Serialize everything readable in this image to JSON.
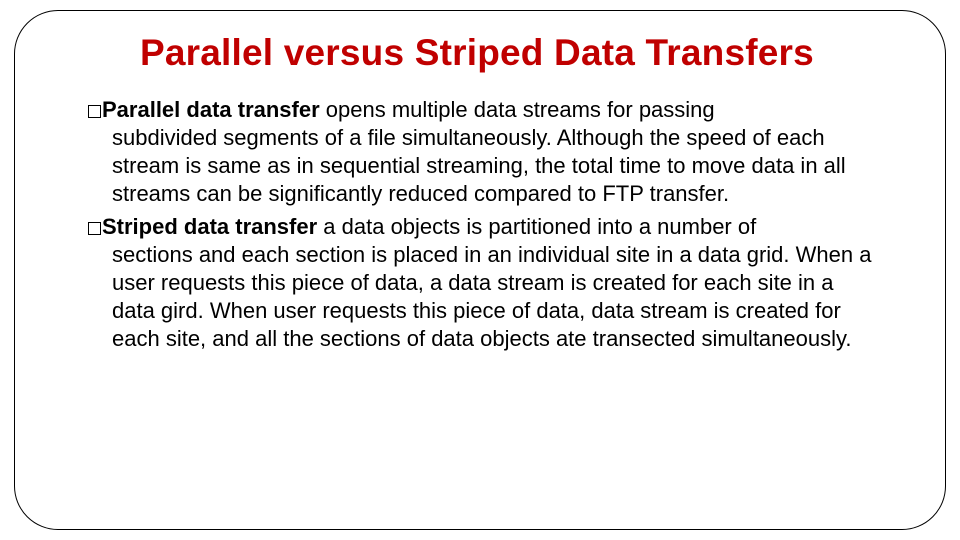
{
  "title": "Parallel versus Striped Data Transfers",
  "items": [
    {
      "lead": "Parallel data transfer",
      "rest_first": " opens multiple data streams for passing",
      "cont": "subdivided segments of a file simultaneously. Although the speed of each stream is same as in sequential streaming, the total time to move data in all streams can be significantly reduced compared to FTP transfer."
    },
    {
      "lead": "Striped data transfer",
      "rest_first": " a data objects is partitioned into a number of",
      "cont": "sections and each section is placed in an individual site in a data grid. When a user requests this piece of data, a data stream is created for each site in a data gird. When user requests this piece of data, data stream is created for each site, and all the sections of data objects ate transected simultaneously."
    }
  ]
}
